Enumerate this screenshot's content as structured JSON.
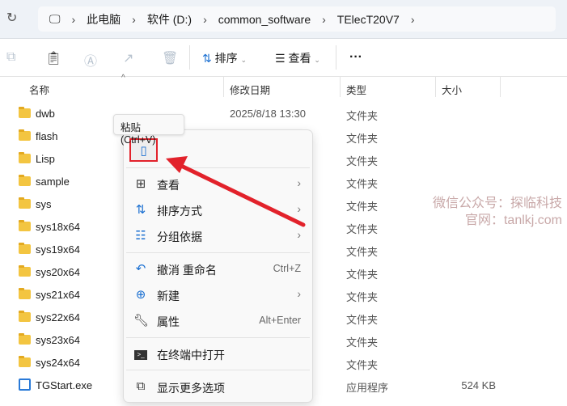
{
  "address": {
    "crumbs": [
      "此电脑",
      "软件 (D:)",
      "common_software",
      "TElecT20V7"
    ]
  },
  "toolbar": {
    "sort": "排序",
    "view": "查看",
    "more": "···"
  },
  "columns": {
    "name": "名称",
    "date": "修改日期",
    "type": "类型",
    "size": "大小"
  },
  "files": [
    {
      "name": "dwb",
      "date": "2025/8/18 13:30",
      "type": "文件夹",
      "size": "",
      "kind": "folder"
    },
    {
      "name": "flash",
      "date": "",
      "type": "文件夹",
      "size": "",
      "kind": "folder"
    },
    {
      "name": "Lisp",
      "date": "",
      "type": "文件夹",
      "size": "",
      "kind": "folder"
    },
    {
      "name": "sample",
      "date": "",
      "type": "文件夹",
      "size": "",
      "kind": "folder"
    },
    {
      "name": "sys",
      "date": "",
      "type": "文件夹",
      "size": "",
      "kind": "folder"
    },
    {
      "name": "sys18x64",
      "date": "",
      "type": "文件夹",
      "size": "",
      "kind": "folder"
    },
    {
      "name": "sys19x64",
      "date": "",
      "type": "文件夹",
      "size": "",
      "kind": "folder"
    },
    {
      "name": "sys20x64",
      "date": "",
      "type": "文件夹",
      "size": "",
      "kind": "folder"
    },
    {
      "name": "sys21x64",
      "date": "",
      "type": "文件夹",
      "size": "",
      "kind": "folder"
    },
    {
      "name": "sys22x64",
      "date": "",
      "type": "文件夹",
      "size": "",
      "kind": "folder"
    },
    {
      "name": "sys23x64",
      "date": "",
      "type": "文件夹",
      "size": "",
      "kind": "folder"
    },
    {
      "name": "sys24x64",
      "date": "",
      "type": "文件夹",
      "size": "",
      "kind": "folder"
    },
    {
      "name": "TGStart.exe",
      "date": "",
      "type": "应用程序",
      "size": "524 KB",
      "kind": "exe"
    }
  ],
  "tooltip": "粘贴 (Ctrl+V)",
  "menu": {
    "view": "查看",
    "sort": "排序方式",
    "group": "分组依据",
    "undo": "撤消 重命名",
    "undo_sc": "Ctrl+Z",
    "new": "新建",
    "props": "属性",
    "props_sc": "Alt+Enter",
    "terminal": "在终端中打开",
    "more": "显示更多选项"
  },
  "watermark": {
    "line1": "微信公众号：探临科技",
    "line2": "官网：tanlkj.com"
  },
  "colors": {
    "annotation": "#e2222b",
    "accent": "#1a6fd1"
  }
}
